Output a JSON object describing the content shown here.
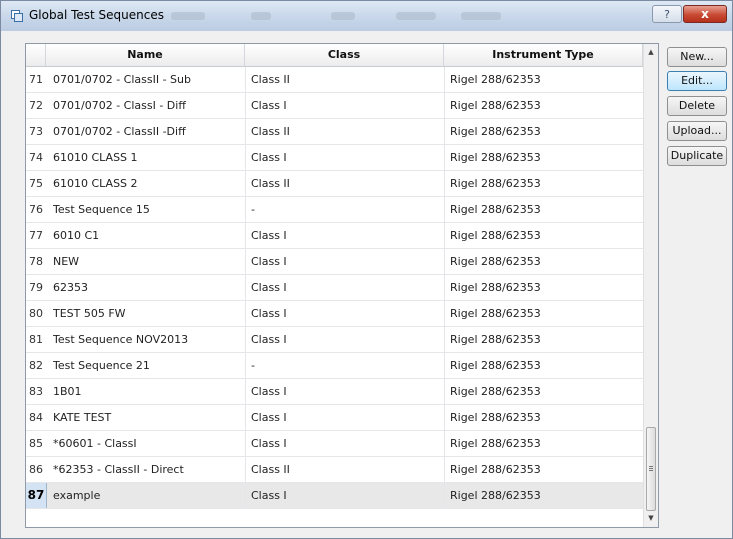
{
  "window": {
    "title": "Global Test Sequences",
    "help_label": "?",
    "close_label": "x",
    "accent_color": "#c84a33"
  },
  "table": {
    "columns": [
      {
        "label": "Name"
      },
      {
        "label": "Class"
      },
      {
        "label": "Instrument Type"
      }
    ],
    "selected_row": 87,
    "rows": [
      {
        "num": "71",
        "name": "0701/0702 - ClassII - Sub",
        "class": "Class II",
        "instrument": "Rigel 288/62353"
      },
      {
        "num": "72",
        "name": "0701/0702 - ClassI - Diff",
        "class": "Class I",
        "instrument": "Rigel 288/62353"
      },
      {
        "num": "73",
        "name": "0701/0702 - ClassII -Diff",
        "class": "Class II",
        "instrument": "Rigel 288/62353"
      },
      {
        "num": "74",
        "name": "61010 CLASS 1",
        "class": "Class I",
        "instrument": "Rigel 288/62353"
      },
      {
        "num": "75",
        "name": "61010 CLASS 2",
        "class": "Class II",
        "instrument": "Rigel 288/62353"
      },
      {
        "num": "76",
        "name": "Test Sequence 15",
        "class": "-",
        "instrument": "Rigel 288/62353"
      },
      {
        "num": "77",
        "name": "6010 C1",
        "class": "Class I",
        "instrument": "Rigel 288/62353"
      },
      {
        "num": "78",
        "name": "NEW",
        "class": "Class I",
        "instrument": "Rigel 288/62353"
      },
      {
        "num": "79",
        "name": "62353",
        "class": "Class I",
        "instrument": "Rigel 288/62353"
      },
      {
        "num": "80",
        "name": "TEST 505 FW",
        "class": "Class I",
        "instrument": "Rigel 288/62353"
      },
      {
        "num": "81",
        "name": "Test Sequence NOV2013",
        "class": "Class I",
        "instrument": "Rigel 288/62353"
      },
      {
        "num": "82",
        "name": "Test Sequence 21",
        "class": "-",
        "instrument": "Rigel 288/62353"
      },
      {
        "num": "83",
        "name": "1B01",
        "class": "Class I",
        "instrument": "Rigel 288/62353"
      },
      {
        "num": "84",
        "name": "KATE TEST",
        "class": "Class I",
        "instrument": "Rigel 288/62353"
      },
      {
        "num": "85",
        "name": "*60601 - ClassI",
        "class": "Class I",
        "instrument": "Rigel 288/62353"
      },
      {
        "num": "86",
        "name": "*62353 - ClassII - Direct",
        "class": "Class II",
        "instrument": "Rigel 288/62353"
      },
      {
        "num": "87",
        "name": "example",
        "class": "Class I",
        "instrument": "Rigel 288/62353"
      }
    ]
  },
  "buttons": {
    "new": "New...",
    "edit": "Edit...",
    "delete": "Delete",
    "upload": "Upload...",
    "duplicate": "Duplicate"
  },
  "scrollbar": {
    "up_icon": "scroll-up-arrow",
    "down_icon": "scroll-down-arrow",
    "up_glyph": "▲",
    "down_glyph": "▼",
    "grip_glyph": "≡"
  }
}
